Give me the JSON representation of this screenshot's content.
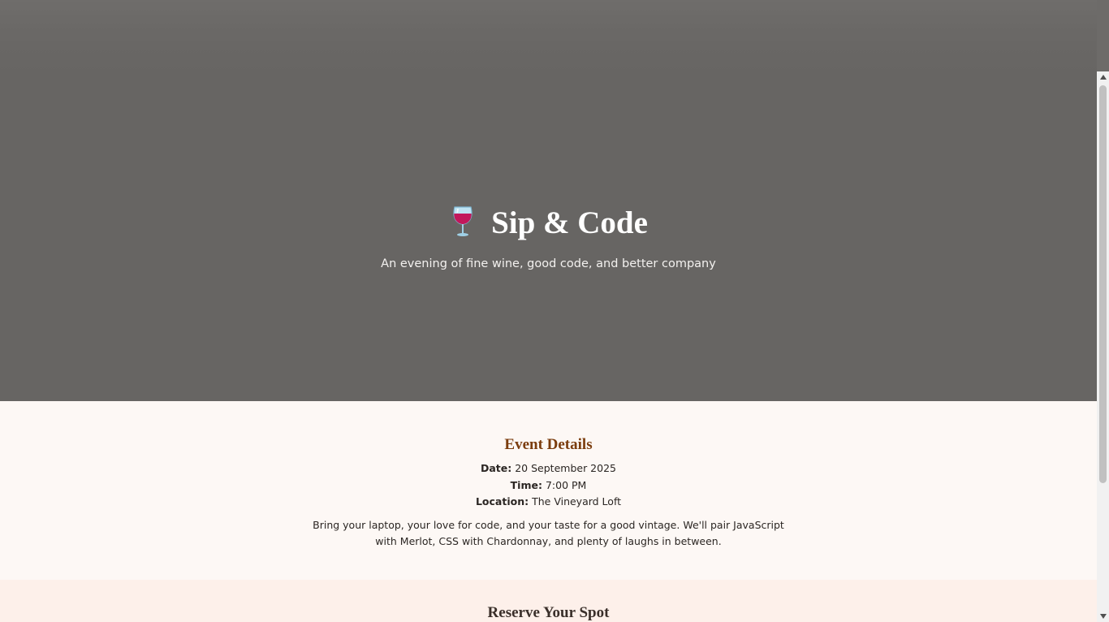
{
  "hero": {
    "title": "Sip & Code",
    "tagline": "An evening of fine wine, good code, and better company",
    "icon": "wine-glass-icon"
  },
  "details": {
    "heading": "Event Details",
    "date_label": "Date:",
    "date_value": "20 September 2025",
    "time_label": "Time:",
    "time_value": "7:00 PM",
    "location_label": "Location:",
    "location_value": "The Vineyard Loft",
    "description": "Bring your laptop, your love for code, and your taste for a good vintage. We'll pair JavaScript with Merlot, CSS with Chardonnay, and plenty of laughs in between."
  },
  "reserve": {
    "heading": "Reserve Your Spot"
  },
  "colors": {
    "hero_bg": "#676563",
    "page_bg": "#fdf8f5",
    "details_heading": "#7b3d0e",
    "reserve_bg": "#fdf0ea",
    "wine": "#c2185b"
  }
}
